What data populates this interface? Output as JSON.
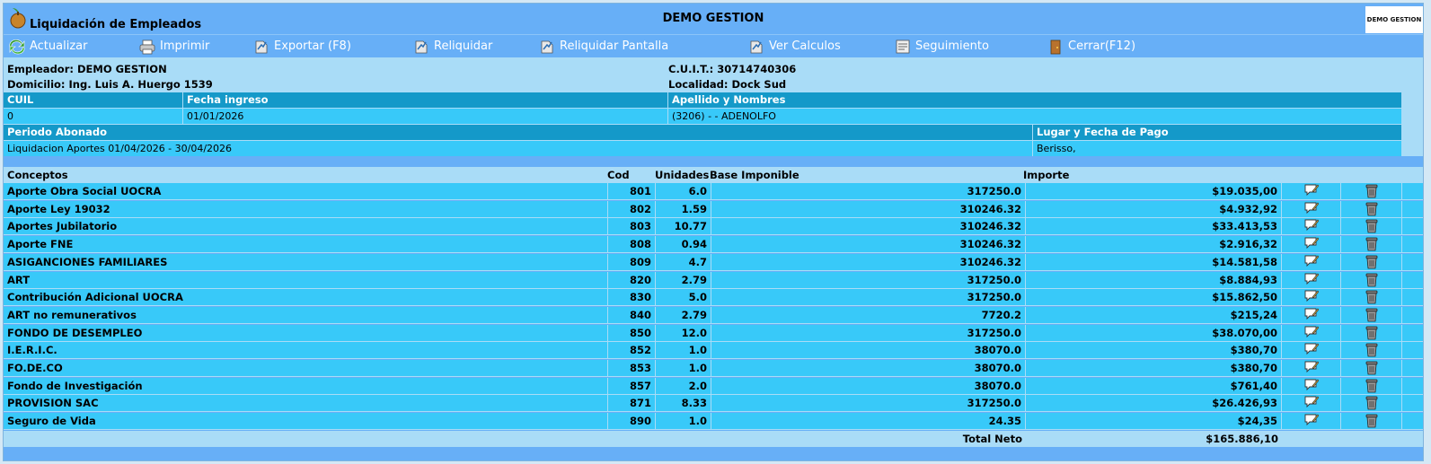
{
  "window": {
    "title": "Liquidación de Empleados",
    "company": "DEMO GESTION",
    "logo_text": "DEMO GESTION"
  },
  "toolbar": [
    {
      "label": "Actualizar",
      "icon": "refresh-icon"
    },
    {
      "label": "Imprimir",
      "icon": "printer-icon"
    },
    {
      "label": "Exportar (F8)",
      "icon": "export-icon"
    },
    {
      "label": "Reliquidar",
      "icon": "recalculate-icon"
    },
    {
      "label": "Reliquidar Pantalla",
      "icon": "recalculate-screen-icon"
    },
    {
      "label": "Ver Calculos",
      "icon": "calculations-icon"
    },
    {
      "label": "Seguimiento",
      "icon": "tracking-icon"
    },
    {
      "label": "Cerrar(F12)",
      "icon": "close-icon"
    }
  ],
  "employer": {
    "empleador": "Empleador: DEMO GESTION",
    "domicilio": "Domicilio: Ing. Luis A. Huergo 1539",
    "cuit": "C.U.I.T.: 30714740306",
    "localidad": "Localidad: Dock Sud"
  },
  "employee": {
    "headers": {
      "cuil": "CUIL",
      "fecha": "Fecha ingreso",
      "nombre": "Apellido y Nombres"
    },
    "cuil": "0",
    "fecha_ingreso": "01/01/2026",
    "nombre": "(3206) - - ADENOLFO"
  },
  "period": {
    "headers": {
      "periodo": "Periodo Abonado",
      "lugar": "Lugar y Fecha de Pago"
    },
    "periodo": "Liquidacion Aportes 01/04/2026 - 30/04/2026",
    "lugar": "Berisso,"
  },
  "columns": {
    "conceptos": "Conceptos",
    "cod": "Cod",
    "unidades": "Unidades",
    "base": "Base Imponible",
    "importe": "Importe"
  },
  "rows": [
    {
      "concepto": "Aporte Obra Social UOCRA",
      "cod": "801",
      "unidades": "6.0",
      "base": "317250.0",
      "importe": "$19.035,00"
    },
    {
      "concepto": "Aporte Ley 19032",
      "cod": "802",
      "unidades": "1.59",
      "base": "310246.32",
      "importe": "$4.932,92"
    },
    {
      "concepto": "Aportes Jubilatorio",
      "cod": "803",
      "unidades": "10.77",
      "base": "310246.32",
      "importe": "$33.413,53"
    },
    {
      "concepto": "Aporte FNE",
      "cod": "808",
      "unidades": "0.94",
      "base": "310246.32",
      "importe": "$2.916,32"
    },
    {
      "concepto": "ASIGANCIONES FAMILIARES",
      "cod": "809",
      "unidades": "4.7",
      "base": "310246.32",
      "importe": "$14.581,58"
    },
    {
      "concepto": "ART",
      "cod": "820",
      "unidades": "2.79",
      "base": "317250.0",
      "importe": "$8.884,93"
    },
    {
      "concepto": "Contribución Adicional UOCRA",
      "cod": "830",
      "unidades": "5.0",
      "base": "317250.0",
      "importe": "$15.862,50"
    },
    {
      "concepto": "ART no remunerativos",
      "cod": "840",
      "unidades": "2.79",
      "base": "7720.2",
      "importe": "$215,24"
    },
    {
      "concepto": "FONDO DE DESEMPLEO",
      "cod": "850",
      "unidades": "12.0",
      "base": "317250.0",
      "importe": "$38.070,00"
    },
    {
      "concepto": "I.E.R.I.C.",
      "cod": "852",
      "unidades": "1.0",
      "base": "38070.0",
      "importe": "$380,70"
    },
    {
      "concepto": "FO.DE.CO",
      "cod": "853",
      "unidades": "1.0",
      "base": "38070.0",
      "importe": "$380,70"
    },
    {
      "concepto": "Fondo de Investigación",
      "cod": "857",
      "unidades": "2.0",
      "base": "38070.0",
      "importe": "$761,40"
    },
    {
      "concepto": "PROVISION SAC",
      "cod": "871",
      "unidades": "8.33",
      "base": "317250.0",
      "importe": "$26.426,93"
    },
    {
      "concepto": "Seguro de Vida",
      "cod": "890",
      "unidades": "1.0",
      "base": "24.35",
      "importe": "$24,35"
    }
  ],
  "row_actions": {
    "edit_icon": "edit-note-icon",
    "delete_icon": "trash-icon"
  },
  "totals": {
    "label": "Total Neto",
    "value": "$165.886,10"
  }
}
